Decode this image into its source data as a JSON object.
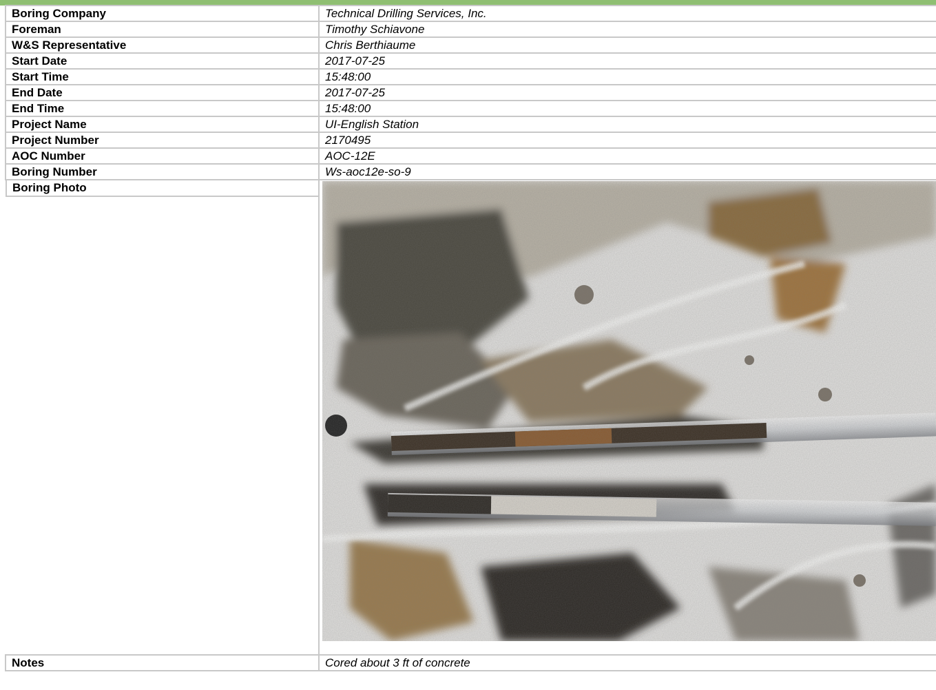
{
  "rows": [
    {
      "label": "Boring Company",
      "value": "Technical Drilling Services, Inc."
    },
    {
      "label": "Foreman",
      "value": "Timothy Schiavone"
    },
    {
      "label": "W&S Representative",
      "value": "Chris Berthiaume"
    },
    {
      "label": "Start Date",
      "value": "2017-07-25"
    },
    {
      "label": "Start Time",
      "value": "15:48:00"
    },
    {
      "label": "End Date",
      "value": "2017-07-25"
    },
    {
      "label": "End Time",
      "value": "15:48:00"
    },
    {
      "label": "Project Name",
      "value": "UI-English Station"
    },
    {
      "label": "Project Number",
      "value": "2170495"
    },
    {
      "label": "AOC Number",
      "value": "AOC-12E"
    },
    {
      "label": "Boring Number",
      "value": "Ws-aoc12e-so-9"
    }
  ],
  "photo_row": {
    "label": "Boring Photo"
  },
  "notes_row": {
    "label": "Notes",
    "value": "Cored about 3 ft of concrete"
  },
  "colors": {
    "header_bar": "#8fbf72",
    "grid_lines": "#c8c8c8"
  }
}
